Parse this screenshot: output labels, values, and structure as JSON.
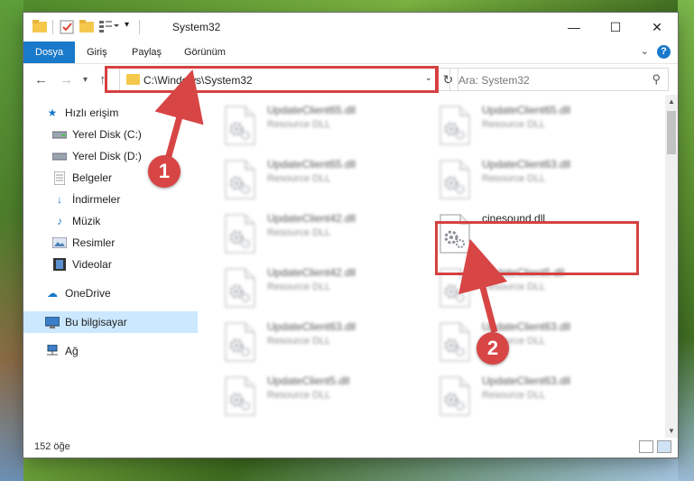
{
  "window": {
    "title": "System32",
    "controls": {
      "minimize": "—",
      "maximize": "☐",
      "close": "✕"
    }
  },
  "ribbon": {
    "tabs": [
      "Dosya",
      "Giriş",
      "Paylaş",
      "Görünüm"
    ],
    "active_tab": "Dosya",
    "help": "?"
  },
  "nav": {
    "address": "C:\\Windows\\System32",
    "search_placeholder": "Ara: System32"
  },
  "sidebar": {
    "quick_access": "Hızlı erişim",
    "items": [
      {
        "label": "Yerel Disk (C:)",
        "icon": "drive-icon",
        "pinned": true
      },
      {
        "label": "Yerel Disk (D:)",
        "icon": "drive-icon",
        "pinned": true
      },
      {
        "label": "Belgeler",
        "icon": "documents-icon",
        "pinned": true
      },
      {
        "label": "İndirmeler",
        "icon": "download-icon",
        "pinned": true
      },
      {
        "label": "Müzik",
        "icon": "music-icon",
        "pinned": true
      },
      {
        "label": "Resimler",
        "icon": "pictures-icon",
        "pinned": true
      },
      {
        "label": "Videolar",
        "icon": "videos-icon",
        "pinned": true
      }
    ],
    "onedrive": "OneDrive",
    "this_pc": "Bu bilgisayar",
    "network": "Ağ"
  },
  "files": [
    {
      "name": "UpdateClient65.dll",
      "type": "Resource DLL",
      "blurred": true
    },
    {
      "name": "UpdateClient65.dll",
      "type": "Resource DLL",
      "blurred": true
    },
    {
      "name": "UpdateClient65.dll",
      "type": "Resource DLL",
      "blurred": true
    },
    {
      "name": "UpdateClient63.dll",
      "type": "Resource DLL",
      "blurred": true
    },
    {
      "name": "UpdateClient42.dll",
      "type": "Resource DLL",
      "blurred": true
    },
    {
      "name": "cinesound.dll",
      "type": "",
      "blurred": false
    },
    {
      "name": "UpdateClient42.dll",
      "type": "Resource DLL",
      "blurred": true
    },
    {
      "name": "UpdateClient5.dll",
      "type": "Resource DLL",
      "blurred": true
    },
    {
      "name": "UpdateClient63.dll",
      "type": "Resource DLL",
      "blurred": true
    },
    {
      "name": "UpdateClient63.dll",
      "type": "Resource DLL",
      "blurred": true
    },
    {
      "name": "UpdateClient5.dll",
      "type": "Resource DLL",
      "blurred": true
    },
    {
      "name": "UpdateClient63.dll",
      "type": "Resource DLL",
      "blurred": true
    }
  ],
  "status": {
    "count": "152 öğe"
  },
  "callouts": {
    "one": "1",
    "two": "2"
  },
  "colors": {
    "accent": "#1979ca",
    "highlight": "#d64040",
    "selected": "#cce8ff"
  }
}
